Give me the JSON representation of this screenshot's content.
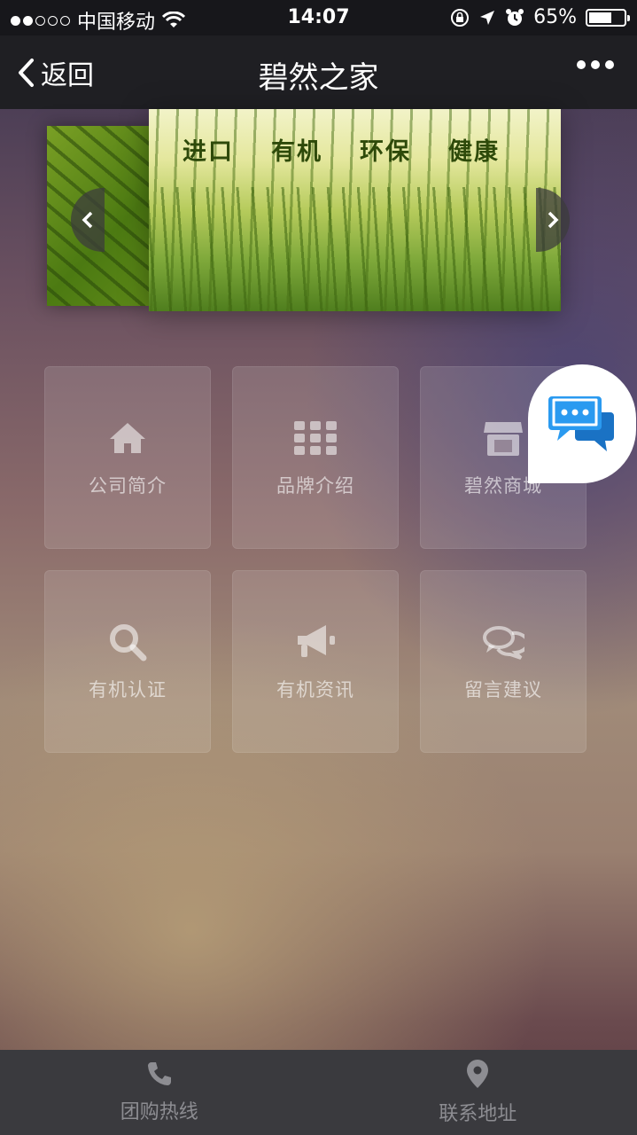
{
  "status_bar": {
    "carrier": "中国移动",
    "time": "14:07",
    "battery_percent": "65%",
    "battery_level": 0.65,
    "signal_dots_filled": 2,
    "signal_dots_total": 5
  },
  "nav": {
    "back_label": "返回",
    "title": "碧然之家"
  },
  "banner": {
    "words": [
      "进口",
      "有机",
      "环保",
      "健康"
    ]
  },
  "grid": {
    "items": [
      {
        "label": "公司简介",
        "icon": "home-icon"
      },
      {
        "label": "品牌介绍",
        "icon": "grid-icon"
      },
      {
        "label": "碧然商城",
        "icon": "store-icon"
      },
      {
        "label": "有机认证",
        "icon": "search-icon"
      },
      {
        "label": "有机资讯",
        "icon": "megaphone-icon"
      },
      {
        "label": "留言建议",
        "icon": "comments-icon"
      }
    ]
  },
  "bottom_bar": {
    "items": [
      {
        "label": "团购热线",
        "icon": "phone-icon"
      },
      {
        "label": "联系地址",
        "icon": "location-pin-icon"
      }
    ]
  },
  "colors": {
    "chat_blue": "#1e8fe6",
    "tile_text": "#bcaeb0"
  }
}
